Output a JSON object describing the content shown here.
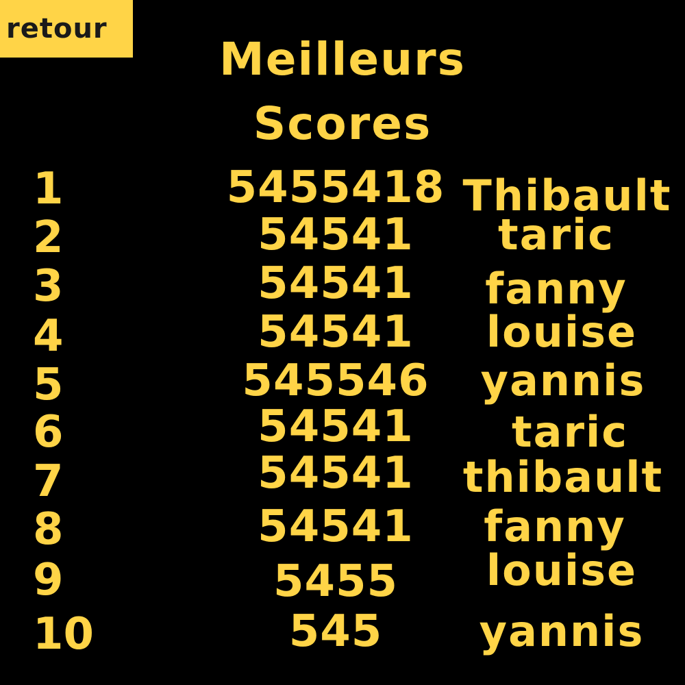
{
  "back_button": {
    "label": "retour"
  },
  "title": {
    "line1": "Meilleurs",
    "line2": "Scores"
  },
  "scores": [
    {
      "rank": "1",
      "score": "5455418",
      "name": "Thibault"
    },
    {
      "rank": "2",
      "score": "54541",
      "name": "taric"
    },
    {
      "rank": "3",
      "score": "54541",
      "name": "fanny"
    },
    {
      "rank": "4",
      "score": "54541",
      "name": "louise"
    },
    {
      "rank": "5",
      "score": "545546",
      "name": "yannis"
    },
    {
      "rank": "6",
      "score": "54541",
      "name": "taric"
    },
    {
      "rank": "7",
      "score": "54541",
      "name": "thibault"
    },
    {
      "rank": "8",
      "score": "54541",
      "name": "fanny"
    },
    {
      "rank": "9",
      "score": "5455",
      "name": "louise"
    },
    {
      "rank": "10",
      "score": "545",
      "name": "yannis"
    }
  ],
  "colors": {
    "accent": "#FFD447",
    "background": "#000000",
    "button_text": "#1a1a1a"
  }
}
